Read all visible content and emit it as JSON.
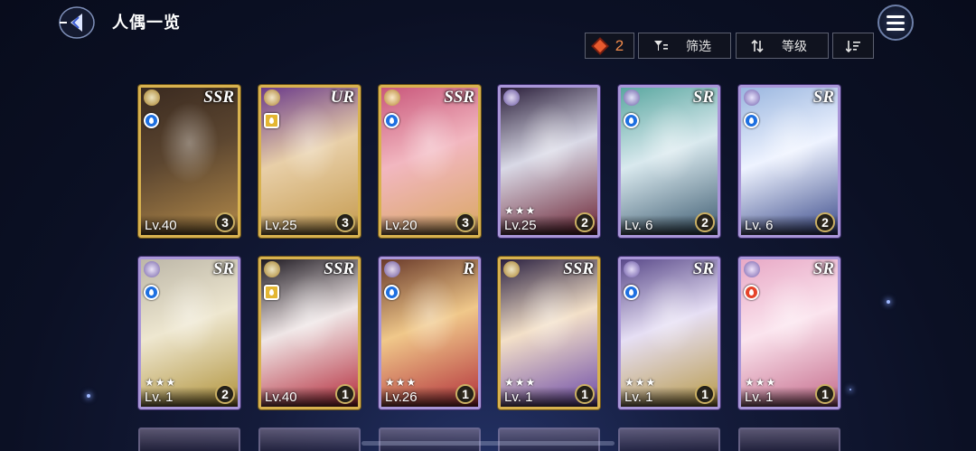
{
  "header": {
    "title": "人偶一览",
    "back_icon": "back-arrow-icon",
    "menu_icon": "hamburger-menu-icon"
  },
  "toolbar": {
    "count": "2",
    "filter_label": "筛选",
    "sort_label": "等级"
  },
  "cards": [
    {
      "rarity": "SSR",
      "level": "Lv.40",
      "count": "3",
      "stars": "",
      "frame": "gold",
      "element": "water",
      "palette": [
        "#3a2a20",
        "#5c4630",
        "#b38a4a"
      ]
    },
    {
      "rarity": "UR",
      "level": "Lv.25",
      "count": "3",
      "stars": "",
      "frame": "gold",
      "element": "gold",
      "palette": [
        "#6b3b8a",
        "#e8cfa8",
        "#c59a4e"
      ]
    },
    {
      "rarity": "SSR",
      "level": "Lv.20",
      "count": "3",
      "stars": "",
      "frame": "gold",
      "element": "water",
      "palette": [
        "#c9577b",
        "#f2b7c0",
        "#d9a762"
      ]
    },
    {
      "rarity": "",
      "level": "Lv.25",
      "count": "2",
      "stars": "★★★",
      "frame": "purple",
      "element": "",
      "palette": [
        "#2a1e3a",
        "#d9d9e6",
        "#6a2131"
      ]
    },
    {
      "rarity": "SR",
      "level": "Lv. 6",
      "count": "2",
      "stars": "",
      "frame": "purple",
      "element": "water",
      "palette": [
        "#5aa7a0",
        "#d9e9ee",
        "#3c5a70"
      ]
    },
    {
      "rarity": "SR",
      "level": "Lv. 6",
      "count": "2",
      "stars": "",
      "frame": "purple",
      "element": "water",
      "palette": [
        "#9ab6df",
        "#eef3ff",
        "#3a4a8a"
      ]
    },
    {
      "rarity": "SR",
      "level": "Lv. 1",
      "count": "2",
      "stars": "★★★",
      "frame": "purple",
      "element": "water",
      "palette": [
        "#bdb7a8",
        "#eee7d0",
        "#b0923a"
      ]
    },
    {
      "rarity": "SSR",
      "level": "Lv.40",
      "count": "1",
      "stars": "",
      "frame": "gold",
      "element": "gold",
      "palette": [
        "#1f1a22",
        "#efe6e6",
        "#b42a3a"
      ]
    },
    {
      "rarity": "R",
      "level": "Lv.26",
      "count": "1",
      "stars": "★★★",
      "frame": "purple",
      "element": "water",
      "palette": [
        "#6a3a2a",
        "#f0c88a",
        "#b2303a"
      ]
    },
    {
      "rarity": "SSR",
      "level": "Lv. 1",
      "count": "1",
      "stars": "★★★",
      "frame": "gold",
      "element": "",
      "palette": [
        "#2a2040",
        "#f3e0c8",
        "#6c4aa8"
      ]
    },
    {
      "rarity": "SR",
      "level": "Lv. 1",
      "count": "1",
      "stars": "★★★",
      "frame": "purple",
      "element": "water",
      "palette": [
        "#5a4a8a",
        "#e6dff4",
        "#b89a4a"
      ]
    },
    {
      "rarity": "SR",
      "level": "Lv. 1",
      "count": "1",
      "stars": "★★★",
      "frame": "purple",
      "element": "fire",
      "palette": [
        "#e8a9c6",
        "#fbe4ee",
        "#c46a8a"
      ]
    }
  ]
}
